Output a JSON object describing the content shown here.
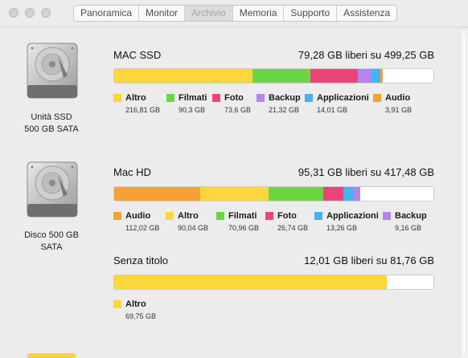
{
  "window": {
    "tabs": [
      {
        "label": "Panoramica",
        "active": false
      },
      {
        "label": "Monitor",
        "active": false
      },
      {
        "label": "Archivio",
        "active": true
      },
      {
        "label": "Memoria",
        "active": false
      },
      {
        "label": "Supporto",
        "active": false
      },
      {
        "label": "Assistenza",
        "active": false
      }
    ]
  },
  "colors": {
    "Altro": "#fcd63a",
    "Filmati": "#6ad742",
    "Foto": "#ec4479",
    "Backup": "#b584ed",
    "Applicazioni": "#44b4f2",
    "Audio": "#f5a134",
    "free": "#ffffff"
  },
  "drives": [
    {
      "label": "Unità SSD\n500 GB SATA",
      "icon": "hard-drive-icon",
      "volumes": [
        {
          "name": "MAC SSD",
          "free_text": "79,28 GB liberi su 499,25 GB",
          "total_gb": 499.25,
          "segments": [
            {
              "name": "Altro",
              "size": "216,81 GB",
              "gb": 216.81
            },
            {
              "name": "Filmati",
              "size": "90,3 GB",
              "gb": 90.3
            },
            {
              "name": "Foto",
              "size": "73,6 GB",
              "gb": 73.6
            },
            {
              "name": "Backup",
              "size": "21,32 GB",
              "gb": 21.32
            },
            {
              "name": "Applicazioni",
              "size": "14,01 GB",
              "gb": 14.01
            },
            {
              "name": "Audio",
              "size": "3,91 GB",
              "gb": 3.91
            }
          ]
        }
      ]
    },
    {
      "label": "Disco 500 GB\nSATA",
      "icon": "hard-drive-icon",
      "volumes": [
        {
          "name": "Mac HD",
          "free_text": "95,31 GB liberi su 417,48 GB",
          "total_gb": 417.48,
          "segments": [
            {
              "name": "Audio",
              "size": "112,02 GB",
              "gb": 112.02
            },
            {
              "name": "Altro",
              "size": "90,04 GB",
              "gb": 90.04
            },
            {
              "name": "Filmati",
              "size": "70,96 GB",
              "gb": 70.96
            },
            {
              "name": "Foto",
              "size": "26,74 GB",
              "gb": 26.74
            },
            {
              "name": "Applicazioni",
              "size": "13,26 GB",
              "gb": 13.26
            },
            {
              "name": "Backup",
              "size": "9,16 GB",
              "gb": 9.16
            }
          ]
        },
        {
          "name": "Senza titolo",
          "free_text": "12,01 GB liberi su 81,76 GB",
          "total_gb": 81.76,
          "segments": [
            {
              "name": "Altro",
              "size": "69,75 GB",
              "gb": 69.75
            }
          ]
        }
      ]
    }
  ]
}
